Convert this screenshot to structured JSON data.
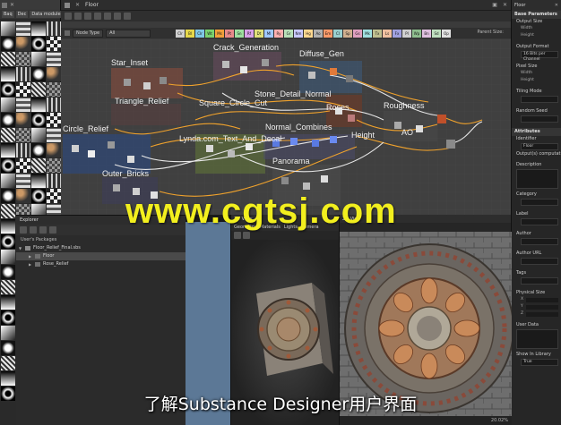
{
  "library": {
    "tabs": [
      "Baq",
      "Dec",
      "Data module"
    ]
  },
  "graph": {
    "window_title": "Floor",
    "filter_dropdown": "Node Type",
    "filter_value": "All",
    "chips": [
      {
        "label": "Clr",
        "color": "#cfcfcf"
      },
      {
        "label": "Bl",
        "color": "#e6d84a"
      },
      {
        "label": "Clr",
        "color": "#7fc7e6"
      },
      {
        "label": "Wt",
        "color": "#7ad36e"
      },
      {
        "label": "Ms",
        "color": "#f2a03a"
      },
      {
        "label": "Pt",
        "color": "#e88a8a"
      },
      {
        "label": "Sn",
        "color": "#9ee0a0"
      },
      {
        "label": "Rf",
        "color": "#d7a0e8"
      },
      {
        "label": "Dt",
        "color": "#e0e07a"
      },
      {
        "label": "Ml",
        "color": "#a0c8ff"
      },
      {
        "label": "Ry",
        "color": "#ffb0b0"
      },
      {
        "label": "Gr",
        "color": "#b8e0b8"
      },
      {
        "label": "Nm",
        "color": "#c8c8ff"
      },
      {
        "label": "Hg",
        "color": "#ffd890"
      },
      {
        "label": "Ao",
        "color": "#b0b0b0"
      },
      {
        "label": "Em",
        "color": "#ff9a6a"
      },
      {
        "label": "Cl",
        "color": "#9ad0d0"
      },
      {
        "label": "Sp",
        "color": "#d0b090"
      },
      {
        "label": "Gs",
        "color": "#e0a0c0"
      },
      {
        "label": "Mk",
        "color": "#a0e0e0"
      },
      {
        "label": "Tx",
        "color": "#c0c090"
      },
      {
        "label": "Ls",
        "color": "#f0c0a0"
      },
      {
        "label": "Fx",
        "color": "#a0a0e0"
      },
      {
        "label": "Pl",
        "color": "#d0d0d0"
      },
      {
        "label": "Wp",
        "color": "#90c090"
      },
      {
        "label": "Bn",
        "color": "#e0c0e0"
      },
      {
        "label": "Sd",
        "color": "#c0e0c0"
      },
      {
        "label": "Op",
        "color": "#e0e0e0"
      }
    ],
    "parent_size": "Parent Size:",
    "frames": [
      {
        "label": "Star_Inset"
      },
      {
        "label": "Crack_Generation"
      },
      {
        "label": "Diffuse_Gen"
      },
      {
        "label": "Triangle_Relief"
      },
      {
        "label": "Stone_Detail_Normal"
      },
      {
        "label": "Square_Circle_Cut"
      },
      {
        "label": "Roses"
      },
      {
        "label": "Roughness"
      },
      {
        "label": "Circle_Relief"
      },
      {
        "label": "Normal_Combines"
      },
      {
        "label": "Lynda.com_Text_And_Decal"
      },
      {
        "label": "Height"
      },
      {
        "label": "AO"
      },
      {
        "label": "Outer_Bricks"
      },
      {
        "label": "Panorama"
      }
    ]
  },
  "properties": {
    "window_title": "Floor",
    "base_parameters": "Base Parameters",
    "output_size": "Output Size",
    "width": "Width",
    "height": "Height",
    "output_format": "Output Format",
    "output_format_value": "16 Bits per Channel",
    "pixel_size": "Pixel Size",
    "tiling_mode": "Tiling Mode",
    "random_seed": "Random Seed",
    "attributes": "Attributes",
    "identifier": "Identifier",
    "identifier_value": "Floor",
    "outputs_computation": "Output(s) computation",
    "description": "Description",
    "category": "Category",
    "label": "Label",
    "author": "Author",
    "author_url": "Author URL",
    "tags": "Tags",
    "physical_size": "Physical Size",
    "axis_x": "X",
    "axis_y": "Y",
    "axis_z": "Z",
    "user_data": "User Data",
    "show_in_library": "Show In Library",
    "show_in_library_value": "True"
  },
  "explorer": {
    "window_title": "Explorer",
    "section": "User's Packages",
    "package": "Floor_Relief_Final.sbs",
    "items": [
      "Floor",
      "Rose_Relief"
    ]
  },
  "view3d": {
    "window_title": "3D View",
    "menu": [
      "Geometry",
      "Materials",
      "Lights",
      "Camera"
    ]
  },
  "view2d": {
    "window_title": "2D View",
    "zoom": "20.02%"
  },
  "overlay": {
    "watermark": "www.cgtsj.com",
    "subtitle": "了解Substance Designer用户界面"
  }
}
